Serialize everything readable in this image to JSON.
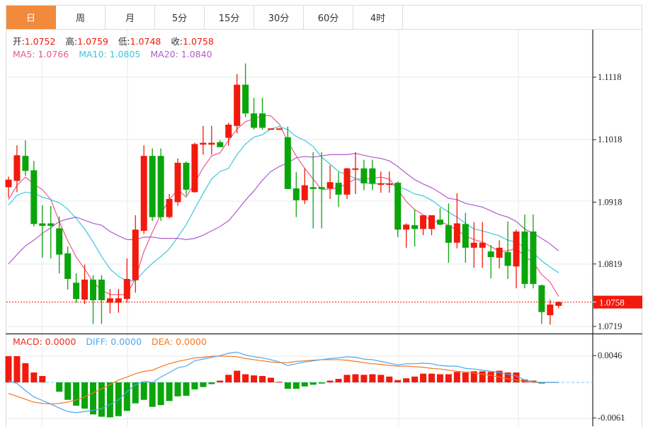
{
  "tabs": [
    {
      "label": "日",
      "active": true
    },
    {
      "label": "周",
      "active": false
    },
    {
      "label": "月",
      "active": false
    },
    {
      "label": "5分",
      "active": false
    },
    {
      "label": "15分",
      "active": false
    },
    {
      "label": "30分",
      "active": false
    },
    {
      "label": "60分",
      "active": false
    },
    {
      "label": "4时",
      "active": false
    }
  ],
  "ohlc": {
    "open_label": "开:",
    "open": "1.0752",
    "high_label": "高:",
    "high": "1.0759",
    "low_label": "低:",
    "low": "1.0748",
    "close_label": "收:",
    "close": "1.0758"
  },
  "ma": {
    "ma5": "MA5: 1.0766",
    "ma10": "MA10: 1.0805",
    "ma20": "MA20: 1.0840"
  },
  "macd_info": {
    "macd": "MACD: 0.0000",
    "diff": "DIFF: 0.0000",
    "dea": "DEA: 0.0000"
  },
  "colors": {
    "up": "#f21a0c",
    "down": "#0aa50a",
    "ma5": "#f0578a",
    "ma10": "#3ac8dc",
    "ma20": "#b05ccc",
    "diff": "#4aa8f0",
    "dea": "#f5771e",
    "tab_active": "#f28a3c"
  },
  "chart_data": [
    {
      "type": "candlestick",
      "title": "",
      "ylim": [
        1.0705,
        1.1158
      ],
      "y_ticks": [
        "1.1118",
        "1.1018",
        "1.0918",
        "1.0819",
        "1.0719"
      ],
      "last_price": "1.0758",
      "candles_ohlc": [
        [
          1.0942,
          1.0954,
          1.0959,
          1.0925
        ],
        [
          1.0952,
          1.0993,
          1.1009,
          1.0934
        ],
        [
          1.0992,
          1.0968,
          1.1017,
          1.096
        ],
        [
          1.0969,
          1.0883,
          1.0984,
          1.0879
        ],
        [
          1.0884,
          1.088,
          1.0913,
          1.0829
        ],
        [
          1.0884,
          1.088,
          1.0912,
          1.0828
        ],
        [
          1.0876,
          1.0834,
          1.0895,
          1.0804
        ],
        [
          1.0836,
          1.0795,
          1.0847,
          1.0778
        ],
        [
          1.0789,
          1.0763,
          1.0804,
          1.0757
        ],
        [
          1.0762,
          1.0794,
          1.0818,
          1.0755
        ],
        [
          1.0794,
          1.0761,
          1.0801,
          1.0723
        ],
        [
          1.0794,
          1.0761,
          1.0801,
          1.0723
        ],
        [
          1.0757,
          1.0764,
          1.0779,
          1.074
        ],
        [
          1.0757,
          1.0764,
          1.0779,
          1.0741
        ],
        [
          1.0763,
          1.0795,
          1.0828,
          1.0757
        ],
        [
          1.0793,
          1.0874,
          1.0897,
          1.0773
        ],
        [
          1.0872,
          1.0992,
          1.1009,
          1.0867
        ],
        [
          1.0992,
          1.0894,
          1.1004,
          1.0888
        ],
        [
          1.0992,
          1.0894,
          1.1004,
          1.0888
        ],
        [
          1.0894,
          1.0923,
          1.0931,
          1.0892
        ],
        [
          1.0918,
          1.0981,
          1.0988,
          1.0912
        ],
        [
          1.0981,
          1.0938,
          1.0983,
          1.0929
        ],
        [
          1.0934,
          1.1011,
          1.1013,
          1.0933
        ],
        [
          1.101,
          1.1013,
          1.104,
          1.0994
        ],
        [
          1.101,
          1.1013,
          1.104,
          1.0994
        ],
        [
          1.1014,
          1.1006,
          1.1017,
          1.1006
        ],
        [
          1.1021,
          1.1042,
          1.1045,
          1.1008
        ],
        [
          1.104,
          1.1106,
          1.1123,
          1.1028
        ],
        [
          1.1106,
          1.106,
          1.114,
          1.1054
        ],
        [
          1.106,
          1.1037,
          1.1085,
          1.1034
        ],
        [
          1.106,
          1.1037,
          1.1085,
          1.1034
        ],
        [
          1.1035,
          1.1036,
          1.1036,
          1.1035
        ],
        [
          1.1035,
          1.1036,
          1.1036,
          1.1035
        ],
        [
          1.1022,
          1.0939,
          1.1039,
          1.0939
        ],
        [
          1.094,
          1.0921,
          1.0966,
          1.0894
        ],
        [
          1.0921,
          1.0945,
          1.0972,
          1.0915
        ],
        [
          1.0942,
          1.0939,
          1.0998,
          1.0876
        ],
        [
          1.0942,
          1.0939,
          1.0998,
          1.0876
        ],
        [
          1.094,
          1.095,
          1.0977,
          1.0923
        ],
        [
          1.0949,
          1.093,
          1.0966,
          1.091
        ],
        [
          1.093,
          1.0972,
          1.0973,
          1.0923
        ],
        [
          1.0971,
          1.0972,
          1.0998,
          1.0931
        ],
        [
          1.0972,
          1.0948,
          1.0986,
          1.0937
        ],
        [
          1.0972,
          1.0948,
          1.0986,
          1.0937
        ],
        [
          1.0947,
          1.0948,
          1.0967,
          1.0933
        ],
        [
          1.0947,
          1.0948,
          1.0967,
          1.0933
        ],
        [
          1.0949,
          1.0874,
          1.0951,
          1.0862
        ],
        [
          1.0874,
          1.0882,
          1.0884,
          1.0845
        ],
        [
          1.0881,
          1.0875,
          1.0906,
          1.0847
        ],
        [
          1.0875,
          1.0897,
          1.0897,
          1.0865
        ],
        [
          1.0875,
          1.0897,
          1.0897,
          1.0865
        ],
        [
          1.089,
          1.0882,
          1.0909,
          1.0881
        ],
        [
          1.0881,
          1.0853,
          1.0916,
          1.0821
        ],
        [
          1.0853,
          1.0884,
          1.0932,
          1.0844
        ],
        [
          1.0883,
          1.0845,
          1.0901,
          1.0821
        ],
        [
          1.0845,
          1.0853,
          1.0886,
          1.0813
        ],
        [
          1.0845,
          1.0853,
          1.0886,
          1.0813
        ],
        [
          1.0839,
          1.083,
          1.0849,
          1.0796
        ],
        [
          1.0829,
          1.0845,
          1.0857,
          1.0812
        ],
        [
          1.0838,
          1.0816,
          1.0887,
          1.0795
        ],
        [
          1.0815,
          1.0871,
          1.0874,
          1.078
        ],
        [
          1.0871,
          1.0787,
          1.0898,
          1.078
        ],
        [
          1.0871,
          1.0787,
          1.0898,
          1.078
        ],
        [
          1.0785,
          1.0742,
          1.0786,
          1.0723
        ],
        [
          1.0737,
          1.0754,
          1.0762,
          1.0722
        ],
        [
          1.0752,
          1.0758,
          1.0759,
          1.0748
        ]
      ],
      "series": [
        {
          "name": "MA5",
          "values": [
            1.0922,
            1.0945,
            1.0958,
            1.0947,
            1.0938,
            1.0922,
            1.0887,
            1.0856,
            1.083,
            1.0811,
            1.079,
            1.0777,
            1.077,
            1.077,
            1.077,
            1.0796,
            1.0839,
            1.087,
            1.0899,
            1.0922,
            1.0938,
            1.0926,
            1.0949,
            1.0973,
            1.0992,
            1.0997,
            1.1017,
            1.1035,
            1.1047,
            1.1051,
            1.1057,
            1.1056,
            1.1043,
            1.1015,
            1.0992,
            1.0972,
            1.0955,
            1.0938,
            1.0939,
            1.0941,
            1.0948,
            1.0955,
            1.0955,
            1.0956,
            1.0958,
            1.0955,
            1.0938,
            1.0919,
            1.0906,
            1.0898,
            1.0887,
            1.0887,
            1.0881,
            1.0873,
            1.0864,
            1.0858,
            1.0854,
            1.0847,
            1.0839,
            1.084,
            1.0844,
            1.0831,
            1.0822,
            1.0802,
            1.079,
            1.0767
          ]
        },
        {
          "name": "MA10",
          "values": [
            1.0913,
            1.0929,
            1.0934,
            1.0932,
            1.0926,
            1.0922,
            1.0917,
            1.0907,
            1.0892,
            1.0875,
            1.0854,
            1.0831,
            1.0811,
            1.0799,
            1.0792,
            1.0792,
            1.0807,
            1.082,
            1.0831,
            1.0843,
            1.0862,
            1.0882,
            1.0907,
            1.0932,
            1.0955,
            1.0967,
            1.0972,
            1.0994,
            1.1011,
            1.1022,
            1.1026,
            1.1035,
            1.1039,
            1.1034,
            1.1023,
            1.1017,
            1.1007,
            1.099,
            1.0979,
            1.0967,
            1.0962,
            1.0956,
            1.0949,
            1.0947,
            1.0948,
            1.0947,
            1.0943,
            1.0938,
            1.0931,
            1.0928,
            1.0921,
            1.0911,
            1.0902,
            1.0894,
            1.0884,
            1.0875,
            1.0872,
            1.0868,
            1.0864,
            1.0857,
            1.0854,
            1.0845,
            1.0837,
            1.0824,
            1.0814,
            1.0805
          ]
        },
        {
          "name": "MA20",
          "values": [
            1.0819,
            1.0834,
            1.0848,
            1.0857,
            1.0868,
            1.0877,
            1.0887,
            1.0891,
            1.0894,
            1.0889,
            1.0884,
            1.0881,
            1.0871,
            1.0864,
            1.0858,
            1.0858,
            1.0862,
            1.0862,
            1.086,
            1.086,
            1.086,
            1.0858,
            1.086,
            1.0865,
            1.0872,
            1.0879,
            1.0888,
            1.0904,
            1.0921,
            1.0936,
            1.0953,
            1.0967,
            1.0975,
            1.0981,
            1.0989,
            1.0991,
            1.099,
            1.0992,
            1.0994,
            1.0994,
            1.0994,
            1.0996,
            1.0993,
            1.099,
            1.0988,
            1.0984,
            1.0975,
            1.0964,
            1.0954,
            1.0947,
            1.0941,
            1.0933,
            1.0924,
            1.0922,
            1.0916,
            1.0913,
            1.091,
            1.0904,
            1.0898,
            1.0894,
            1.0887,
            1.0875,
            1.0868,
            1.086,
            1.0851,
            1.084
          ]
        }
      ]
    },
    {
      "type": "bar+line",
      "title": "MACD",
      "ylim": [
        -0.0067,
        0.0083
      ],
      "y_ticks": [
        "0.0046",
        "-0.0061"
      ],
      "macd": [
        0.0045,
        0.0045,
        0.0033,
        0.0017,
        0.0011,
        0,
        -0.0016,
        -0.003,
        -0.004,
        -0.0045,
        -0.0055,
        -0.0059,
        -0.006,
        -0.0058,
        -0.0049,
        -0.0036,
        -0.003,
        -0.0042,
        -0.0039,
        -0.0032,
        -0.0024,
        -0.0023,
        -0.0012,
        -0.0008,
        -0.0003,
        0.0003,
        0.0013,
        0.002,
        0.0014,
        0.0012,
        0.0011,
        0.0008,
        0.0001,
        -0.0011,
        -0.0011,
        -0.0007,
        -0.0004,
        -0.0002,
        0.0003,
        0.0006,
        0.0013,
        0.0014,
        0.0013,
        0.0014,
        0.0013,
        0.001,
        0.0004,
        0.0007,
        0.001,
        0.0015,
        0.0015,
        0.0014,
        0.0014,
        0.0018,
        0.0017,
        0.0019,
        0.0019,
        0.0018,
        0.002,
        0.0017,
        0.0017,
        0.0005,
        0.0003,
        -0.0002,
        0,
        0
      ],
      "diff": [
        0.0003,
        -0.0002,
        -0.0014,
        -0.0025,
        -0.0031,
        -0.0037,
        -0.0044,
        -0.005,
        -0.0052,
        -0.005,
        -0.0048,
        -0.0045,
        -0.0038,
        -0.003,
        -0.0016,
        -0.0004,
        0.0002,
        0.0,
        0.0009,
        0.0017,
        0.0025,
        0.0028,
        0.0037,
        0.004,
        0.0043,
        0.0046,
        0.005,
        0.0052,
        0.0047,
        0.0044,
        0.0042,
        0.0039,
        0.0035,
        0.0029,
        0.0032,
        0.0035,
        0.0037,
        0.0039,
        0.0041,
        0.0042,
        0.0044,
        0.0043,
        0.004,
        0.0039,
        0.0036,
        0.0033,
        0.003,
        0.0032,
        0.0032,
        0.0033,
        0.0032,
        0.0029,
        0.0028,
        0.0028,
        0.0024,
        0.0023,
        0.0021,
        0.0019,
        0.0017,
        0.0014,
        0.0011,
        0.0004,
        0.0001,
        0.0,
        0.0,
        0.0
      ],
      "dea": [
        -0.0019,
        -0.0024,
        -0.0029,
        -0.0034,
        -0.0036,
        -0.0037,
        -0.0036,
        -0.0034,
        -0.003,
        -0.0025,
        -0.0018,
        -0.0011,
        -0.0004,
        0.0004,
        0.0009,
        0.0015,
        0.0019,
        0.0021,
        0.0027,
        0.0032,
        0.0036,
        0.0039,
        0.0042,
        0.0043,
        0.0045,
        0.0045,
        0.0045,
        0.0044,
        0.0041,
        0.0039,
        0.0037,
        0.0035,
        0.0034,
        0.0034,
        0.0036,
        0.0037,
        0.0038,
        0.0039,
        0.0039,
        0.0039,
        0.0038,
        0.0036,
        0.0034,
        0.0032,
        0.0031,
        0.0029,
        0.0028,
        0.0028,
        0.0027,
        0.0026,
        0.0024,
        0.0023,
        0.0021,
        0.0019,
        0.0018,
        0.0016,
        0.0014,
        0.0012,
        0.0009,
        0.0006,
        0.0004,
        0.0002,
        0.0,
        0.0,
        0.0,
        0.0
      ]
    }
  ]
}
